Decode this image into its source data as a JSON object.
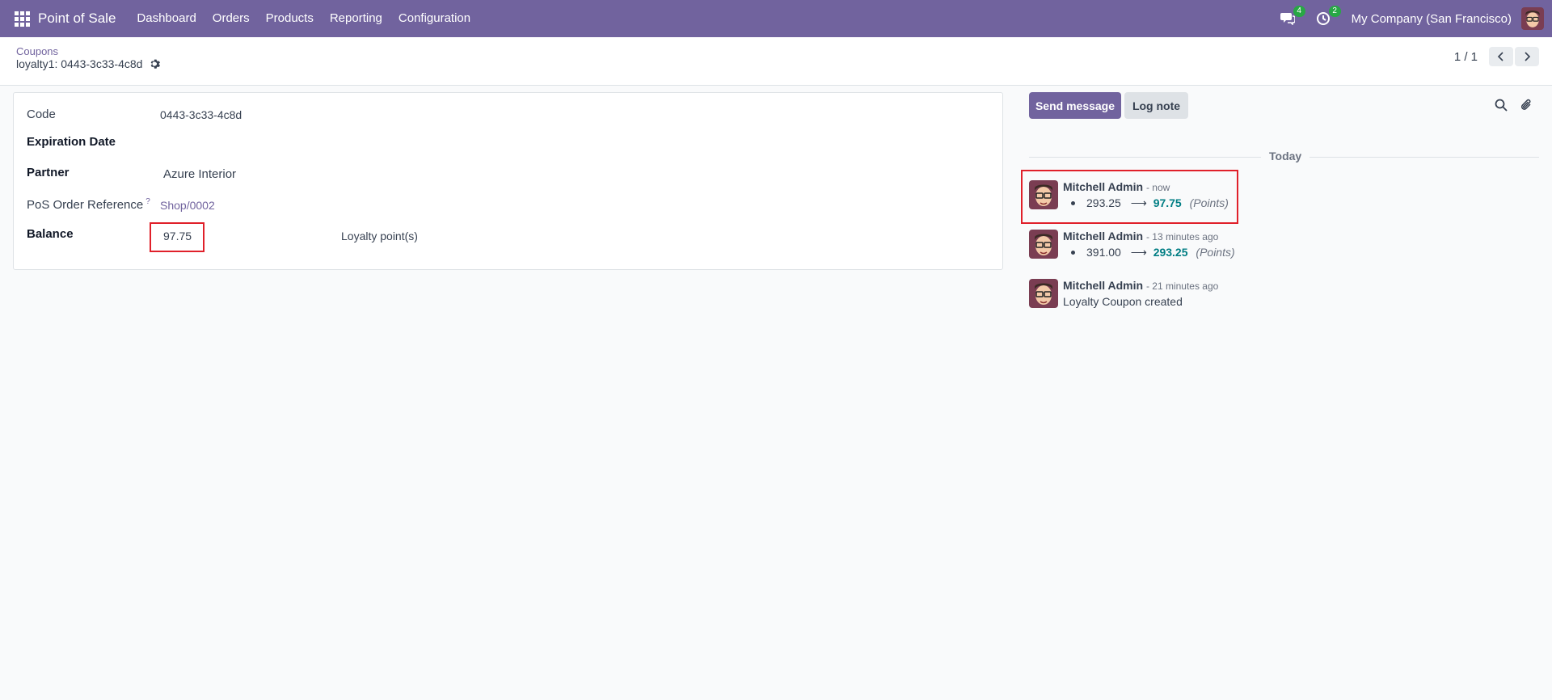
{
  "navbar": {
    "app_name": "Point of Sale",
    "menu": [
      "Dashboard",
      "Orders",
      "Products",
      "Reporting",
      "Configuration"
    ],
    "messages_badge": "4",
    "activities_badge": "2",
    "company": "My Company (San Francisco)",
    "color": "#71639e"
  },
  "control_panel": {
    "breadcrumb": "Coupons",
    "record_title": "loyalty1: 0443-3c33-4c8d",
    "pager_value": "1 / 1"
  },
  "form": {
    "code_label": "Code",
    "code_value": "0443-3c33-4c8d",
    "expiration_label": "Expiration Date",
    "partner_label": "Partner",
    "partner_value": "Azure Interior",
    "pos_ref_label": "PoS Order Reference",
    "pos_ref_help": "?",
    "pos_ref_value": "Shop/0002",
    "balance_label": "Balance",
    "balance_value": "97.75",
    "balance_unit": "Loyalty point(s)"
  },
  "chatter": {
    "send_label": "Send message",
    "log_label": "Log note",
    "today_label": "Today",
    "messages": [
      {
        "author": "Mitchell Admin",
        "time": "- now",
        "old": "293.25",
        "arrow": "⟶",
        "new": "97.75",
        "field": "(Points)"
      },
      {
        "author": "Mitchell Admin",
        "time": "- 13 minutes ago",
        "old": "391.00",
        "arrow": "⟶",
        "new": "293.25",
        "field": "(Points)"
      },
      {
        "author": "Mitchell Admin",
        "time": "- 21 minutes ago",
        "text": "Loyalty Coupon created"
      }
    ]
  },
  "colors": {
    "brand": "#71639e",
    "highlight": "#e0202a",
    "tracking_value": "#017e84",
    "badge": "#28a745"
  }
}
